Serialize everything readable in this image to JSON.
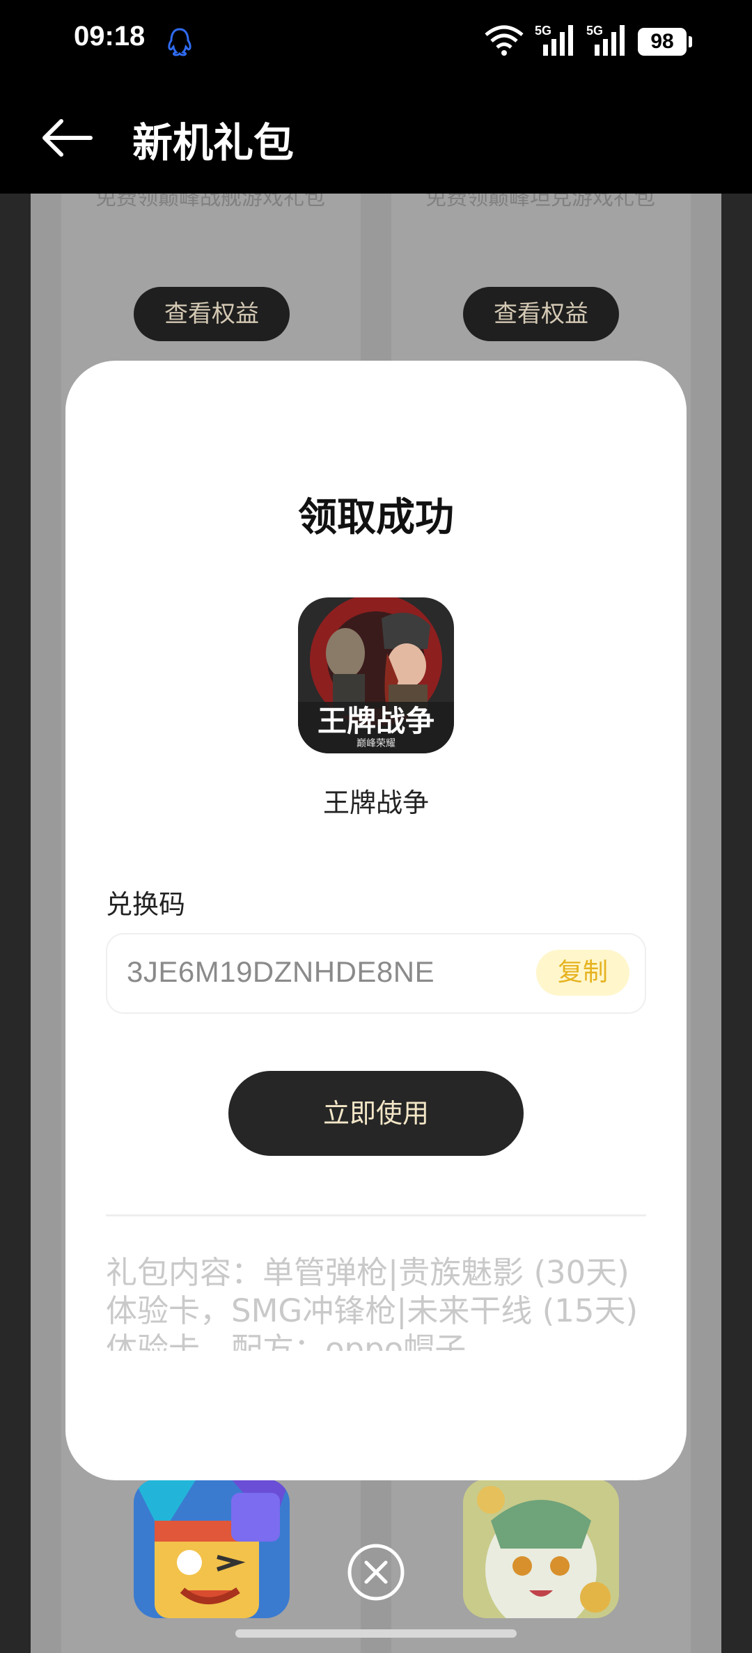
{
  "status_bar": {
    "time": "09:18",
    "battery": "98",
    "network_1": "5G",
    "network_2": "5G"
  },
  "header": {
    "title": "新机礼包"
  },
  "background": {
    "cards": [
      {
        "description": "免费领巅峰战舰游戏礼包",
        "button": "查看权益"
      },
      {
        "description": "免费领巅峰坦克游戏礼包",
        "button": "查看权益"
      }
    ]
  },
  "dialog": {
    "title": "领取成功",
    "game_name": "王牌战争",
    "game_icon_text": "王牌战争",
    "game_icon_subtext": "巅峰荣耀",
    "code_label": "兑换码",
    "code_value": "3JE6M19DZNHDE8NE",
    "copy_label": "复制",
    "use_label": "立即使用",
    "gift_content": "礼包内容：单管弹枪|贵族魅影 (30天)\n体验卡，SMG冲锋枪|未来干线 (15天)\n体验卡，配方：oppo帽子\n领取规则：日常活动-礼包码-输入礼包\n码即可获得奖励"
  },
  "colors": {
    "accent_copy": "#e6b21e",
    "button_dark": "#262626"
  },
  "icons": [
    "qq-icon",
    "wifi-icon",
    "signal-icon",
    "battery-icon",
    "back-arrow-icon",
    "close-icon"
  ]
}
